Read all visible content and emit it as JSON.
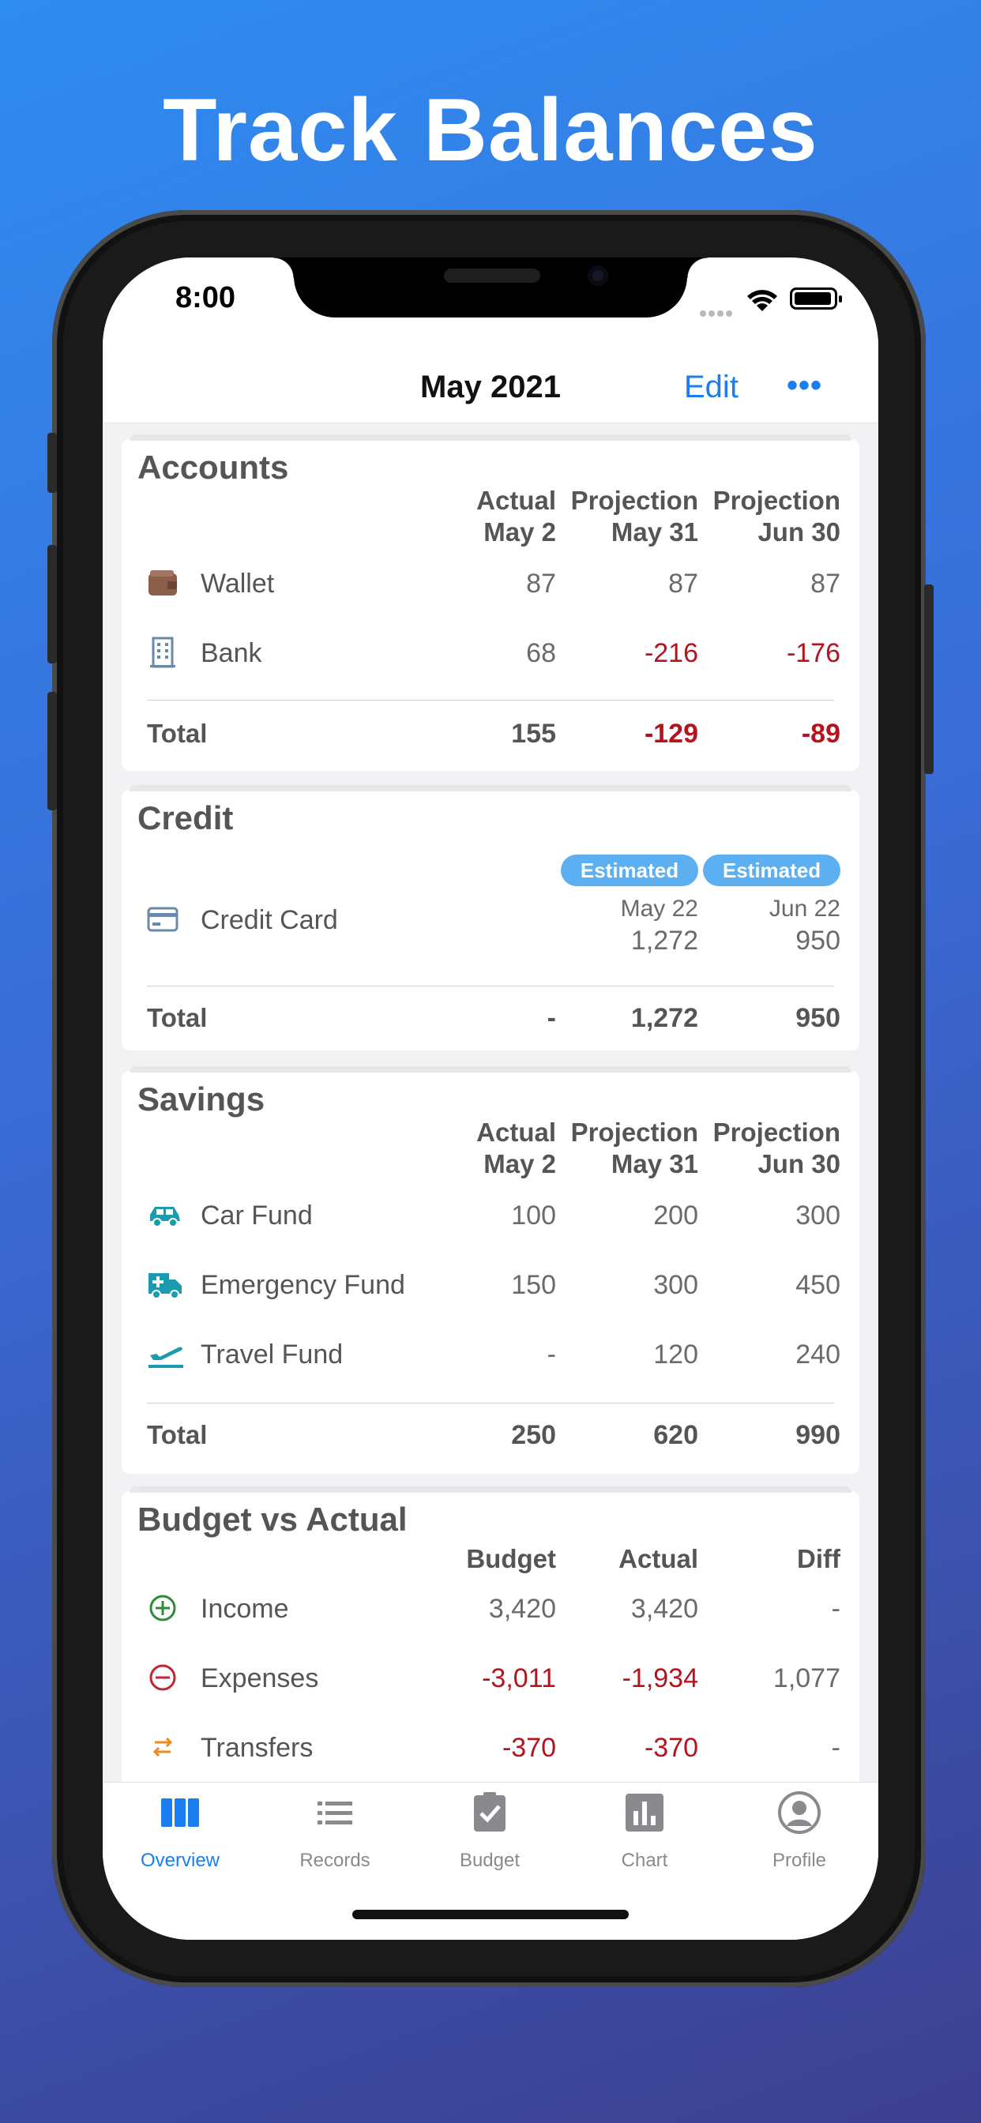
{
  "headline": "Track Balances",
  "status": {
    "time": "8:00"
  },
  "nav": {
    "title": "May 2021",
    "edit": "Edit",
    "more": "•••"
  },
  "accounts": {
    "title": "Accounts",
    "headers": [
      {
        "top": "Actual",
        "bottom": "May 2"
      },
      {
        "top": "Projection",
        "bottom": "May 31"
      },
      {
        "top": "Projection",
        "bottom": "Jun 30"
      }
    ],
    "rows": [
      {
        "label": "Wallet",
        "icon": "wallet-icon",
        "values": [
          "87",
          "87",
          "87"
        ]
      },
      {
        "label": "Bank",
        "icon": "bank-building-icon",
        "values": [
          "68",
          "-216",
          "-176"
        ]
      }
    ],
    "total": {
      "label": "Total",
      "values": [
        "155",
        "-129",
        "-89"
      ]
    }
  },
  "credit": {
    "title": "Credit",
    "badges": [
      "Estimated",
      "Estimated"
    ],
    "row": {
      "label": "Credit Card",
      "icon": "credit-card-icon",
      "dates": [
        "May 22",
        "Jun 22"
      ],
      "values": [
        "1,272",
        "950"
      ]
    },
    "total": {
      "label": "Total",
      "values": [
        "-",
        "1,272",
        "950"
      ]
    }
  },
  "savings": {
    "title": "Savings",
    "headers": [
      {
        "top": "Actual",
        "bottom": "May 2"
      },
      {
        "top": "Projection",
        "bottom": "May 31"
      },
      {
        "top": "Projection",
        "bottom": "Jun 30"
      }
    ],
    "rows": [
      {
        "label": "Car Fund",
        "icon": "car-icon",
        "values": [
          "100",
          "200",
          "300"
        ]
      },
      {
        "label": "Emergency Fund",
        "icon": "ambulance-icon",
        "values": [
          "150",
          "300",
          "450"
        ]
      },
      {
        "label": "Travel Fund",
        "icon": "airplane-icon",
        "values": [
          "-",
          "120",
          "240"
        ]
      }
    ],
    "total": {
      "label": "Total",
      "values": [
        "250",
        "620",
        "990"
      ]
    }
  },
  "budget": {
    "title": "Budget vs Actual",
    "headers": [
      "Budget",
      "Actual",
      "Diff"
    ],
    "rows": [
      {
        "label": "Income",
        "icon": "plus-circle-icon",
        "values": [
          "3,420",
          "3,420",
          "-"
        ]
      },
      {
        "label": "Expenses",
        "icon": "minus-circle-icon",
        "values": [
          "-3,011",
          "-1,934",
          "1,077"
        ]
      },
      {
        "label": "Transfers",
        "icon": "transfer-arrows-icon",
        "values": [
          "-370",
          "-370",
          "-"
        ]
      }
    ]
  },
  "tabs": [
    {
      "label": "Overview",
      "icon": "columns-icon",
      "active": true
    },
    {
      "label": "Records",
      "icon": "list-icon",
      "active": false
    },
    {
      "label": "Budget",
      "icon": "clipboard-check-icon",
      "active": false
    },
    {
      "label": "Chart",
      "icon": "bar-chart-icon",
      "active": false
    },
    {
      "label": "Profile",
      "icon": "person-circle-icon",
      "active": false
    }
  ],
  "colors": {
    "accent": "#1a7df0",
    "negative": "#b5141e",
    "badge": "#5caff0",
    "icon_teal": "#1a9bb0",
    "icon_brown": "#8b5e4a",
    "income_green": "#2e8b3a",
    "expense_red": "#c0262d",
    "transfer_orange": "#f08a1c"
  }
}
